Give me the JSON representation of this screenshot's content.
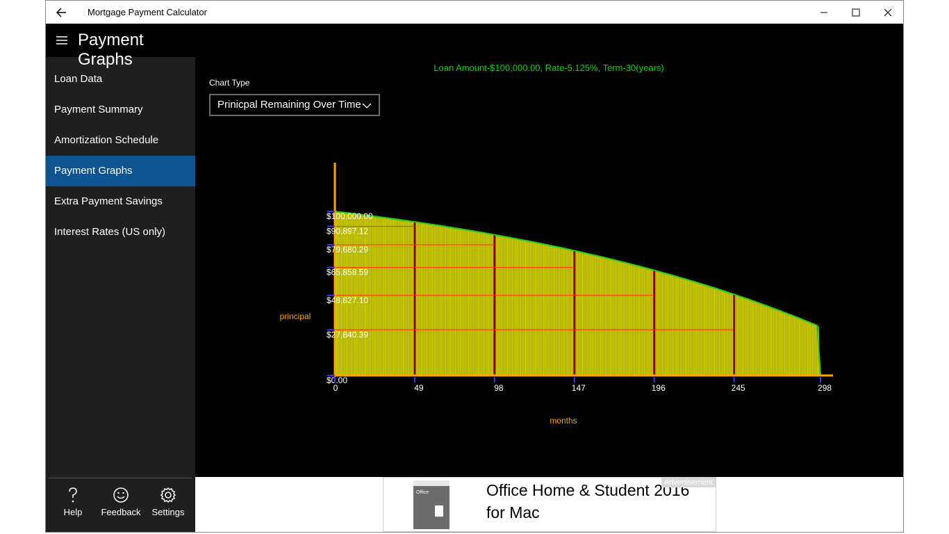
{
  "app": {
    "title": "Mortgage Payment Calculator"
  },
  "nav": {
    "title": "Payment Graphs",
    "items": [
      {
        "label": "Loan Data",
        "active": false
      },
      {
        "label": "Payment Summary",
        "active": false
      },
      {
        "label": "Amortization Schedule",
        "active": false
      },
      {
        "label": "Payment Graphs",
        "active": true
      },
      {
        "label": "Extra Payment Savings",
        "active": false
      },
      {
        "label": "Interest Rates (US only)",
        "active": false
      }
    ],
    "bottom": [
      {
        "label": "Help",
        "icon": "question-icon"
      },
      {
        "label": "Feedback",
        "icon": "smiley-icon"
      },
      {
        "label": "Settings",
        "icon": "gear-icon"
      }
    ]
  },
  "chart_controls": {
    "chart_type_label": "Chart Type",
    "selected": "Prinicpal Remaining Over Time"
  },
  "chart_data": {
    "type": "bar",
    "title": "Loan Amount-$100,000.00, Rate-5.125%, Term-30(years)",
    "xlabel": "months",
    "ylabel": "principal",
    "x_ticks": [
      0,
      49,
      98,
      147,
      196,
      245,
      298
    ],
    "x_tick_labels": [
      "0",
      "49",
      "98",
      "147",
      "196",
      "245",
      "298"
    ],
    "y_tick_labels": [
      "$100,000.00",
      "$90,897.12",
      "$79,680.29",
      "$65,858.59",
      "$48,827.10",
      "$27,840.39",
      "$0.00"
    ],
    "y_ticks": [
      100000.0,
      90897.12,
      79680.29,
      65858.59,
      48827.1,
      27840.39,
      0
    ],
    "xlim": [
      0,
      298
    ],
    "ylim": [
      0,
      100000
    ],
    "highlight_months": [
      49,
      98,
      147,
      196,
      245
    ],
    "colors": {
      "title": "#00dd00",
      "axis": "#ffa500",
      "bar_fill": "#c8c800",
      "bar_line": "#e0e000",
      "grid_line": "#ff2a00",
      "highlight_bar": "#8b0000",
      "curve": "#22cc22",
      "tick_mark": "#3333ff"
    }
  },
  "ad": {
    "headline": "Office Home & Student 2016 for Mac",
    "badge": "Advertisement",
    "thumb_text": "Office"
  }
}
